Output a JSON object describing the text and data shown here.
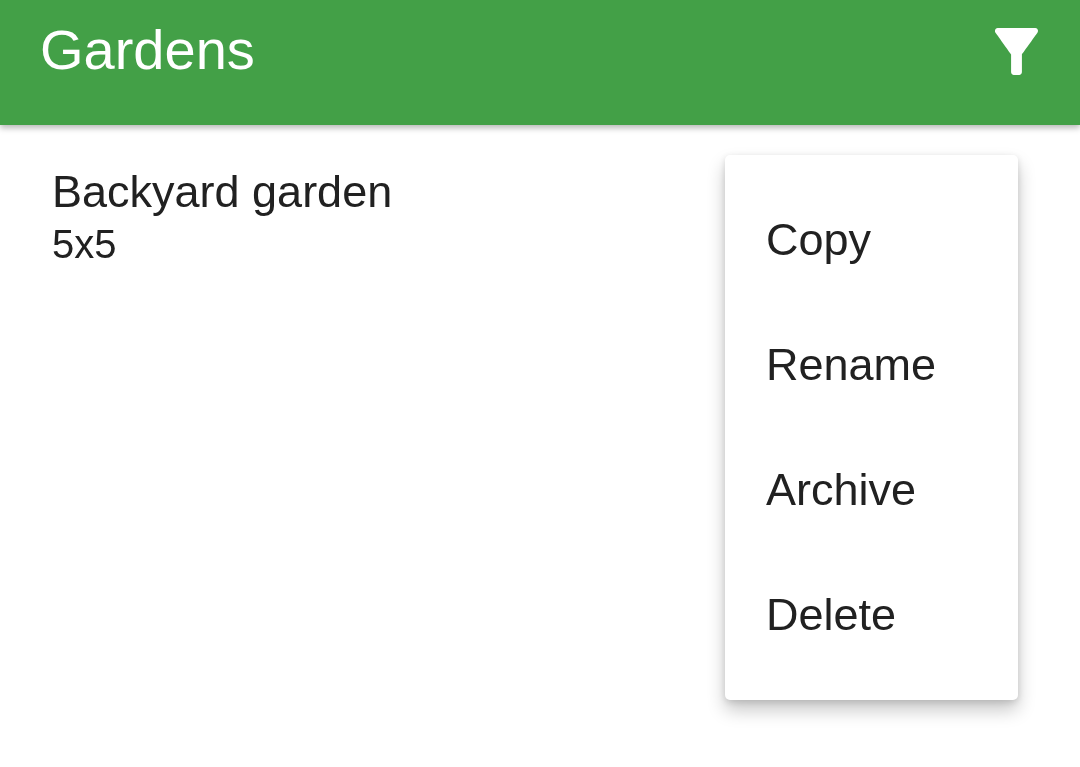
{
  "app_bar": {
    "title": "Gardens"
  },
  "gardens": [
    {
      "name": "Backyard garden",
      "size": "5x5"
    }
  ],
  "context_menu": {
    "items": [
      {
        "label": "Copy"
      },
      {
        "label": "Rename"
      },
      {
        "label": "Archive"
      },
      {
        "label": "Delete"
      }
    ]
  }
}
